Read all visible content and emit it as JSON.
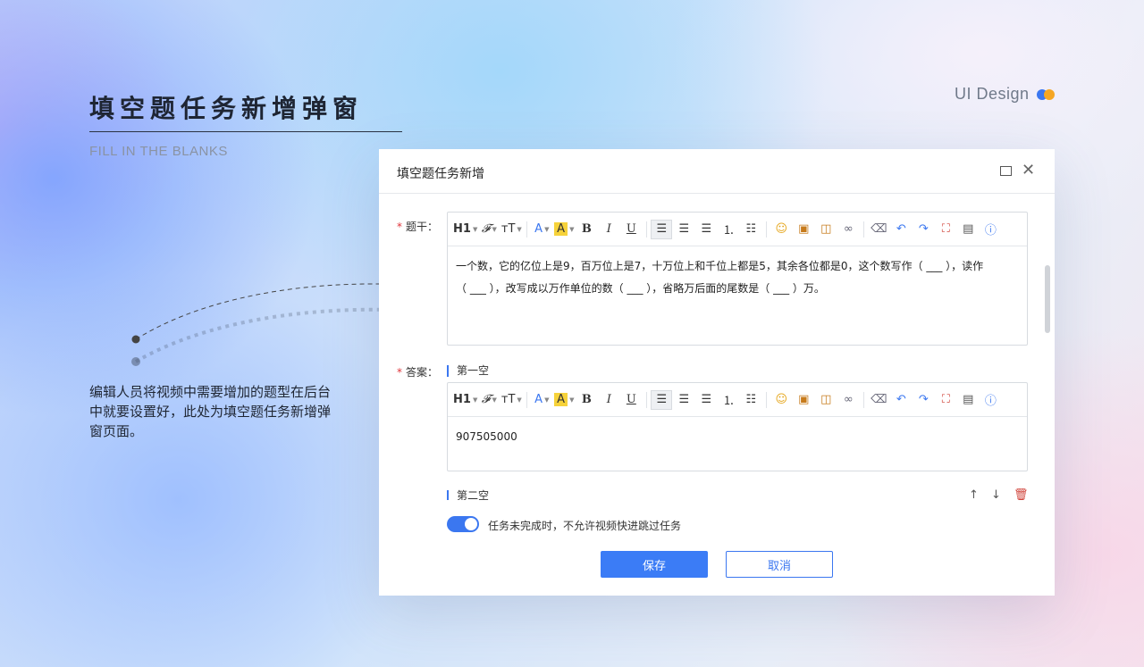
{
  "page": {
    "title_cn": "填空题任务新增弹窗",
    "title_en": "FILL IN THE BLANKS",
    "brand": "UI Design",
    "description": "编辑人员将视频中需要增加的题型在后台中就要设置好，此处为填空题任务新增弹窗页面。"
  },
  "modal": {
    "title": "填空题任务新增",
    "stem_label": "题干：",
    "stem_text_line1": "一个数，它的亿位上是9，百万位上是7，十万位上和千位上都是5，其余各位都是0，这个数写作（ ___ ），读作",
    "stem_text_line2": "（ ___ ），改写成以万作单位的数（ ___ ），省略万后面的尾数是（ ___ ）万。",
    "answer_label": "答案：",
    "blank1_label": "第一空",
    "blank1_value": "907505000",
    "blank2_label": "第二空",
    "toggle_text": "任务未完成时，不允许视频快进跳过任务",
    "save_label": "保存",
    "cancel_label": "取消"
  },
  "toolbar": {
    "heading": "H1",
    "font_family": "𝓕",
    "font_size": "ᴛT",
    "font_color": "A",
    "highlight": "A",
    "bold": "B",
    "italic": "I",
    "underline": "U"
  },
  "colors": {
    "accent": "#3b77f0",
    "brand_blue": "#3b77f0",
    "brand_orange": "#f5a623",
    "required": "#e0353b"
  }
}
